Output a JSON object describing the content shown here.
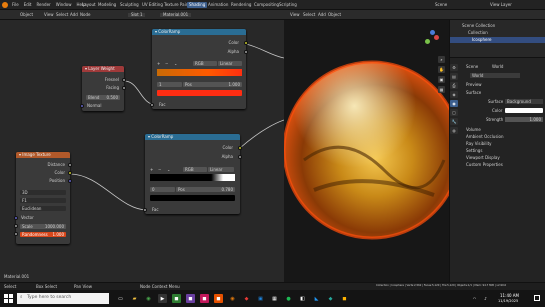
{
  "window": {
    "title": "Blender"
  },
  "menu": {
    "items": [
      "File",
      "Edit",
      "Render",
      "Window",
      "Help"
    ]
  },
  "workspaces": [
    {
      "label": "Layout",
      "active": false
    },
    {
      "label": "Modeling",
      "active": false
    },
    {
      "label": "Sculpting",
      "active": false
    },
    {
      "label": "UV Editing",
      "active": false
    },
    {
      "label": "Texture Paint",
      "active": false
    },
    {
      "label": "Shading",
      "active": true
    },
    {
      "label": "Animation",
      "active": false
    },
    {
      "label": "Rendering",
      "active": false
    },
    {
      "label": "Compositing",
      "active": false
    },
    {
      "label": "Scripting",
      "active": false
    }
  ],
  "top_right": {
    "scene": "Scene",
    "view_layer": "View Layer"
  },
  "node_header": {
    "editor": "Object",
    "view": "View",
    "select": "Select",
    "add": "Add",
    "node": "Node",
    "slot": "Slot 1",
    "material": "Material.001"
  },
  "viewport_header": {
    "view": "View",
    "select": "Select",
    "add": "Add",
    "object": "Object"
  },
  "nodes": {
    "colorramp_top": {
      "title": "ColorRamp",
      "out_color": "Color",
      "out_alpha": "Alpha",
      "mode": "RGB",
      "interp": "Linear",
      "index": "1",
      "pos_label": "Pos",
      "pos_value": "1.000",
      "in_fac": "Fac"
    },
    "layer_weight": {
      "title": "Layer Weight",
      "out_fresnel": "Fresnel",
      "out_facing": "Facing",
      "blend_label": "Blend",
      "blend_value": "0.500",
      "in_normal": "Normal"
    },
    "colorramp_bottom": {
      "title": "ColorRamp",
      "out_color": "Color",
      "out_alpha": "Alpha",
      "mode": "RGB",
      "interp": "Linear",
      "index": "0",
      "pos_label": "Pos",
      "pos_value": "0.780",
      "in_fac": "Fac"
    },
    "image_texture": {
      "title": "Image Texture",
      "out_distance": "Distance",
      "out_color": "Color",
      "out_position": "Position",
      "dim": "3D",
      "proj": "F1",
      "metric": "Euclidean",
      "in_vector": "Vector",
      "scale_label": "Scale",
      "scale_value": "1000.000",
      "rand_label": "Randomness",
      "rand_value": "1.000"
    }
  },
  "outliner": {
    "title": "Scene Collection",
    "items": [
      {
        "label": "Collection"
      },
      {
        "label": "Icosphere"
      }
    ]
  },
  "properties": {
    "tab_scene": "Scene",
    "tab_world": "World",
    "world_name": "World",
    "sections": [
      "Preview",
      "Surface"
    ],
    "surface_label": "Surface",
    "surface_value": "Background",
    "color_label": "Color",
    "strength_label": "Strength",
    "strength_value": "1.000",
    "collapsed": [
      "Volume",
      "Ambient Occlusion",
      "Ray Visibility",
      "Settings",
      "Viewport Display",
      "Custom Properties"
    ]
  },
  "node_area_label": "Material.001",
  "status_bar": {
    "left1": "Select",
    "left2": "Box Select",
    "left3": "Pan View",
    "left4": "Node Context Menu",
    "right": "Collection | Icosphere | Verts:2,562 | Faces:5,120 | Tris:5,120 | Objects:1/1 | Mem: 94.7 MiB | v2.90.0"
  },
  "taskbar": {
    "search_placeholder": "Type here to search",
    "time": "11:40 AM",
    "date": "11/19/2025"
  },
  "colors": {
    "colorramp_header": "#2a6d94",
    "layerweight_header": "#a03a3a",
    "imagetex_header": "#b1592a",
    "accent": "#3d5f8d"
  }
}
